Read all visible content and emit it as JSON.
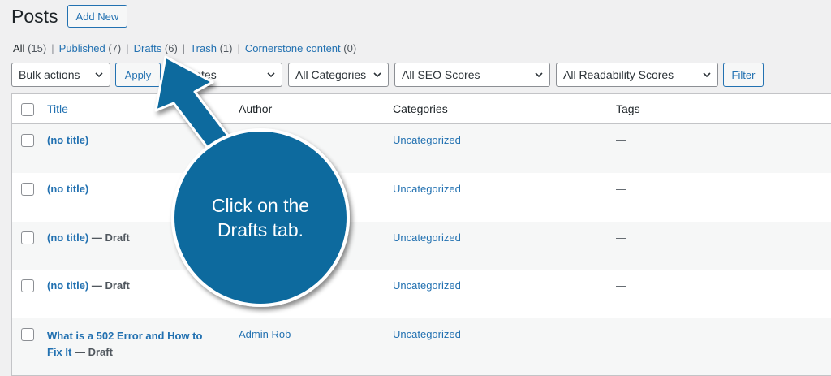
{
  "header": {
    "title": "Posts",
    "add_new": "Add New"
  },
  "filters": {
    "all": {
      "label": "All",
      "count": "(15)"
    },
    "published": {
      "label": "Published",
      "count": "(7)"
    },
    "drafts": {
      "label": "Drafts",
      "count": "(6)"
    },
    "trash": {
      "label": "Trash",
      "count": "(1)"
    },
    "cornerstone": {
      "label": "Cornerstone content",
      "count": "(0)"
    }
  },
  "toolbar": {
    "bulk_actions": "Bulk actions",
    "apply": "Apply",
    "dates": "All dates",
    "categories": "All Categories",
    "seo": "All SEO Scores",
    "readability": "All Readability Scores",
    "filter": "Filter"
  },
  "table": {
    "headers": {
      "title": "Title",
      "author": "Author",
      "categories": "Categories",
      "tags": "Tags"
    },
    "rows": [
      {
        "title": "(no title)",
        "state": "",
        "author": "",
        "category": "Uncategorized",
        "tags": "—"
      },
      {
        "title": "(no title)",
        "state": "",
        "author": "",
        "category": "Uncategorized",
        "tags": "—"
      },
      {
        "title": "(no title)",
        "state": "— Draft",
        "author": "",
        "category": "Uncategorized",
        "tags": "—"
      },
      {
        "title": "(no title)",
        "state": "— Draft",
        "author": "",
        "category": "Uncategorized",
        "tags": "—"
      },
      {
        "title_line1": "What is a 502 Error and How to",
        "title_line2": "Fix It",
        "state": "— Draft",
        "author": "Admin Rob",
        "category": "Uncategorized",
        "tags": "—"
      }
    ]
  },
  "callout": {
    "line1": "Click on the",
    "line2": "Drafts tab.",
    "color": "#0f6a9e"
  },
  "colors": {
    "accent": "#2271b1",
    "background": "#f0f0f1"
  }
}
